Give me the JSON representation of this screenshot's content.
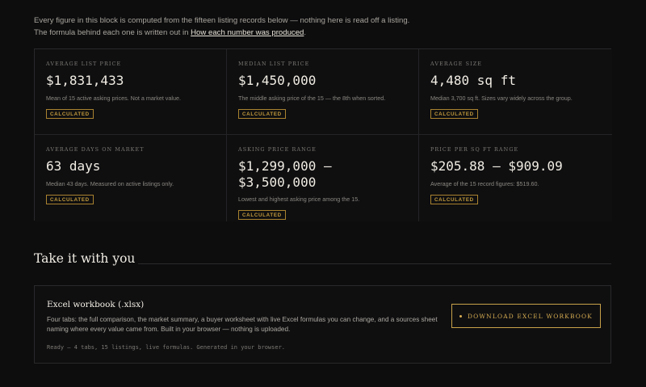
{
  "intro": {
    "line1": "Every figure in this block is computed from the fifteen listing records below — nothing here is read off a listing.",
    "line2_prefix": "The formula behind each one is written out in ",
    "line2_link": "How each number was produced",
    "line2_suffix": "."
  },
  "stats": [
    {
      "label": "AVERAGE LIST PRICE",
      "value": "$1,831,433",
      "desc": "Mean of 15 active asking prices. Not a market value.",
      "badge": "CALCULATED"
    },
    {
      "label": "MEDIAN LIST PRICE",
      "value": "$1,450,000",
      "desc": "The middle asking price of the 15 — the 8th when sorted.",
      "badge": "CALCULATED"
    },
    {
      "label": "AVERAGE SIZE",
      "value": "4,480 sq ft",
      "desc": "Median 3,700 sq ft. Sizes vary widely across the group.",
      "badge": "CALCULATED"
    },
    {
      "label": "AVERAGE DAYS ON MARKET",
      "value": "63 days",
      "desc": "Median 43 days. Measured on active listings only.",
      "badge": "CALCULATED"
    },
    {
      "label": "ASKING PRICE RANGE",
      "value": "$1,299,000 – $3,500,000",
      "desc": "Lowest and highest asking price among the 15.",
      "badge": "CALCULATED"
    },
    {
      "label": "PRICE PER SQ FT RANGE",
      "value": "$205.88 – $909.09",
      "desc": "Average of the 15 record figures: $519.60.",
      "badge": "CALCULATED"
    }
  ],
  "section": {
    "title": "Take it with you"
  },
  "panel": {
    "title": "Excel workbook (.xlsx)",
    "desc": "Four tabs: the full comparison, the market summary, a buyer worksheet with live Excel formulas you can change, and a sources sheet naming where every value came from. Built in your browser — nothing is uploaded.",
    "status": "Ready — 4 tabs, 15 listings, live formulas. Generated in your browser.",
    "button_label": "DOWNLOAD EXCEL WORKBOOK"
  }
}
